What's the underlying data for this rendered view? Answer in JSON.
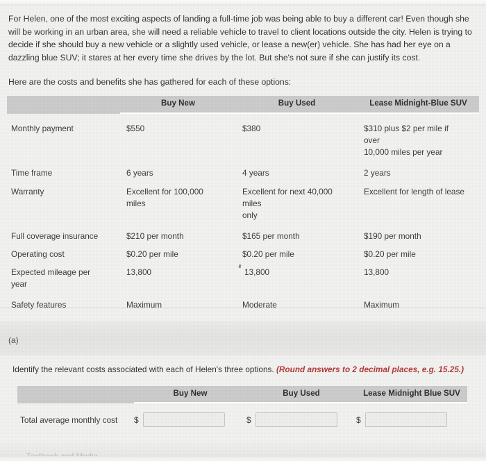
{
  "intro": {
    "paragraph1": "For Helen, one of the most exciting aspects of landing a full-time job was being able to buy a different car! Even though she will be working in an urban area, she will need a reliable vehicle to travel to client locations outside the city. Helen is trying to decide if she should buy a new vehicle or a slightly used vehicle, or lease a new(er) vehicle. She has had her eye on a dazzling blue SUV; it stares at her every time she drives by the lot. But she's not sure if she can justify its cost.",
    "paragraph2": "Here are the costs and benefits she has gathered for each of these options:"
  },
  "comparison_table": {
    "headers": {
      "label": "",
      "buy_new": "Buy New",
      "buy_used": "Buy Used",
      "lease": "Lease Midnight-Blue SUV"
    },
    "rows": [
      {
        "label": "Monthly payment",
        "buy_new": "$550",
        "buy_used": "$380",
        "lease": "$310 plus $2 per mile if over\n10,000 miles per year"
      },
      {
        "label": "Time frame",
        "buy_new": "6 years",
        "buy_used": "4 years",
        "lease": "2 years"
      },
      {
        "label": "Warranty",
        "buy_new": "Excellent for 100,000 miles",
        "buy_used": "Excellent for next 40,000 miles only",
        "lease": "Excellent for length of lease"
      },
      {
        "label": "Full coverage insurance",
        "buy_new": "$210 per month",
        "buy_used": "$165 per month",
        "lease": "$190 per month"
      },
      {
        "label": "Operating cost",
        "buy_new": "$0.20 per mile",
        "buy_used": "$0.20 per mile",
        "lease": "$0.20 per mile"
      },
      {
        "label": "Expected mileage per year",
        "buy_new": "13,800",
        "buy_used": "13,800",
        "lease": "13,800"
      },
      {
        "label": "Safety features",
        "buy_new": "Maximum",
        "buy_used": "Moderate",
        "lease": "Maximum"
      }
    ],
    "lease_monthly_line1": "$310 plus $2 per mile if",
    "lease_monthly_line2": "over",
    "lease_monthly_line3": "10,000 miles per year",
    "warranty_new_line1": "Excellent for 100,000",
    "warranty_new_line2": "miles",
    "warranty_used_line1": "Excellent for next 40,000 miles",
    "warranty_used_line2": "only",
    "mileage_label_line1": "Expected mileage per",
    "mileage_label_line2": "year"
  },
  "part": {
    "marker": "(a)"
  },
  "question": {
    "text": "Identify the relevant costs associated with each of Helen's three options. ",
    "hint": "(Round answers to 2 decimal places, e.g. 15.25.)"
  },
  "answer_table": {
    "headers": {
      "label": "",
      "buy_new": "Buy New",
      "buy_used": "Buy Used",
      "lease": "Lease Midnight Blue SUV"
    },
    "row_label": "Total average monthly cost",
    "currency_symbol": "$",
    "inputs": {
      "buy_new_value": "",
      "buy_used_value": "",
      "lease_value": "",
      "placeholder": ""
    }
  },
  "bottom": {
    "cut_off_text": "Textbook and Media"
  },
  "colors": {
    "page_background": "#f2f2f0",
    "table_header_gray": "#cbcbcb",
    "hint_red": "#b23a3a",
    "text": "#333333",
    "input_border": "#c6c6c4"
  }
}
